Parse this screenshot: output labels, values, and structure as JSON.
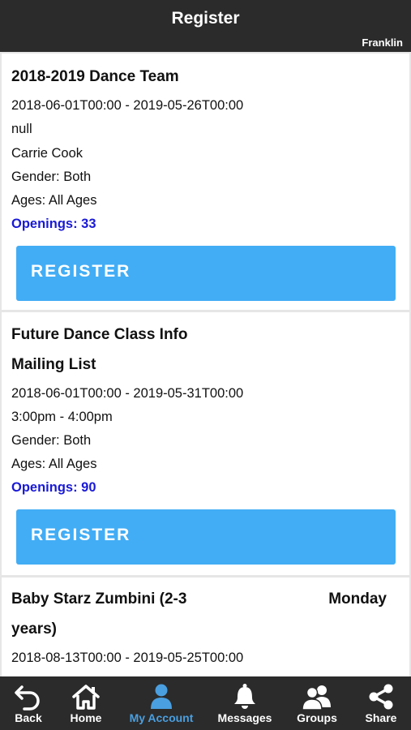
{
  "header": {
    "title": "Register",
    "location": "Franklin"
  },
  "cards": [
    {
      "title": "2018-2019 Dance Team",
      "dates": "2018-06-01T00:00 - 2019-05-26T00:00",
      "time": "null",
      "instructor": "Carrie Cook",
      "gender": "Gender: Both",
      "ages": "Ages: All Ages",
      "openings": "Openings: 33",
      "button": "REGISTER"
    },
    {
      "title_line1": "Future Dance Class Info",
      "title_line2": "Mailing List",
      "dates": "2018-06-01T00:00 - 2019-05-31T00:00",
      "time": "3:00pm - 4:00pm",
      "gender": "Gender: Both",
      "ages": "Ages: All Ages",
      "openings": "Openings: 90",
      "button": "REGISTER"
    },
    {
      "title_line1": "Baby Starz Zumbini (2-3",
      "title_line2": "years)",
      "day": "Monday",
      "dates": "2018-08-13T00:00 - 2019-05-25T00:00"
    }
  ],
  "tabs": [
    {
      "label": "Back",
      "icon": "back-arrow-icon"
    },
    {
      "label": "Home",
      "icon": "home-icon"
    },
    {
      "label": "My Account",
      "icon": "user-icon",
      "active": true
    },
    {
      "label": "Messages",
      "icon": "bell-icon"
    },
    {
      "label": "Groups",
      "icon": "groups-icon"
    },
    {
      "label": "Share",
      "icon": "share-icon"
    }
  ],
  "colors": {
    "bar": "#2b2b2b",
    "button": "#42adf5",
    "openings": "#1a1ad6",
    "active_tab": "#4a9fe0"
  }
}
